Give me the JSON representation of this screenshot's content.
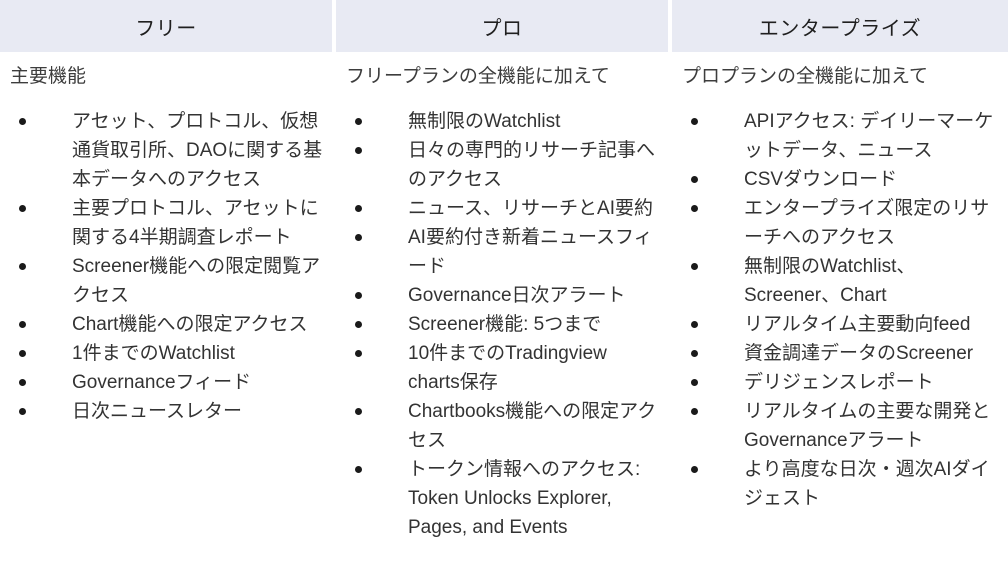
{
  "table": {
    "columns": [
      {
        "header": "フリー",
        "intro": "主要機能",
        "features": [
          "アセット、プロトコル、仮想通貨取引所、DAOに関する基本データへのアクセス",
          "主要プロトコル、アセットに関する4半期調査レポート",
          "Screener機能への限定閲覧アクセス",
          "Chart機能への限定アクセス",
          "1件までのWatchlist",
          "Governanceフィード",
          "日次ニュースレター"
        ]
      },
      {
        "header": "プロ",
        "intro": "フリープランの全機能に加えて",
        "features": [
          "無制限のWatchlist",
          "日々の専門的リサーチ記事へのアクセス",
          "ニュース、リサーチとAI要約",
          "AI要約付き新着ニュースフィード",
          "Governance日次アラート",
          "Screener機能: 5つまで",
          "10件までのTradingview charts保存",
          "Chartbooks機能への限定アクセス",
          "トークン情報へのアクセス: Token Unlocks Explorer, Pages, and Events"
        ]
      },
      {
        "header": "エンタープライズ",
        "intro": "プロプランの全機能に加えて",
        "features": [
          "APIアクセス: デイリーマーケットデータ、ニュース",
          "CSVダウンロード",
          "エンタープライズ限定のリサーチへのアクセス",
          "無制限のWatchlist、Screener、Chart",
          "リアルタイム主要動向feed",
          "資金調達データのScreener",
          "デリジェンスレポート",
          "リアルタイムの主要な開発とGovernanceアラート",
          "より高度な日次・週次AIダイジェスト"
        ]
      }
    ]
  },
  "colors": {
    "header_background": "#e8eaf3",
    "page_background": "#ffffff",
    "text": "#333333",
    "bullet": "#1a1a1a"
  }
}
